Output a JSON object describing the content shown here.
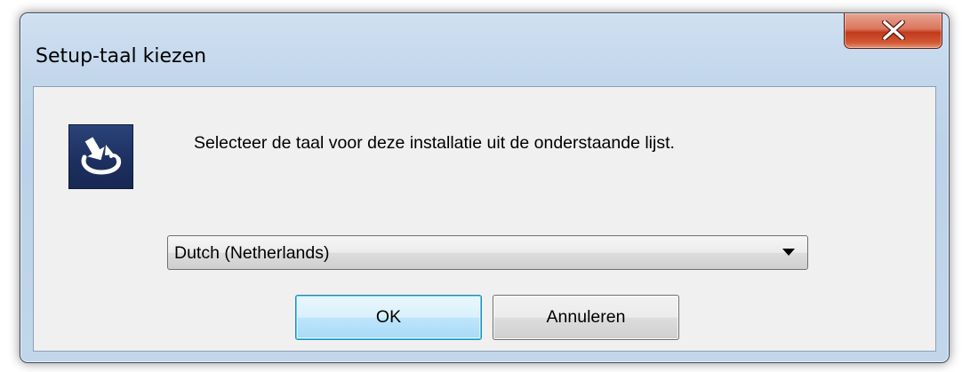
{
  "window": {
    "title": "Setup-taal kiezen",
    "close_icon": "close-icon"
  },
  "dialog": {
    "icon": "setup-installer-icon",
    "message": "Selecteer de taal voor deze installatie uit de onderstaande lijst.",
    "language_select": {
      "selected": "Dutch (Netherlands)",
      "arrow_icon": "dropdown-arrow-icon"
    },
    "buttons": {
      "ok_label": "OK",
      "cancel_label": "Annuleren"
    }
  },
  "colors": {
    "close_button": "#c2391b",
    "ok_button_border": "#3c7fb1",
    "icon_background": "#1c2f5f"
  }
}
